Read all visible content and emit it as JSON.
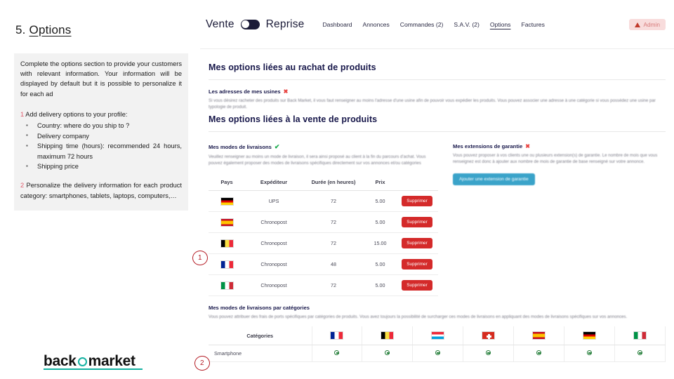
{
  "slide": {
    "number": "5.",
    "title": "Options",
    "intro": "Complete the options section to provide your customers with relevant information. Your information will be displayed by default but it is possible to personalize it for each ad",
    "step1_num": "1",
    "step1_title": "Add delivery options to your profile:",
    "step1_bullets": [
      "Country: where do you ship to ?",
      "Delivery company",
      "Shipping time (hours): recommended 24 hours, maximum 72 hours",
      "Shipping price"
    ],
    "step2_num": "2",
    "step2_text": "Personalize the delivery information for each product category: smartphones, tablets, laptops, computers,…",
    "annotation_1": "1",
    "annotation_2": "2"
  },
  "logo": {
    "left": "back",
    "right": "market",
    "ring_color": "#13b1a1"
  },
  "app": {
    "mode_left": "Vente",
    "mode_right": "Reprise",
    "toggle_state": "left",
    "nav": [
      {
        "label": "Dashboard",
        "active": false
      },
      {
        "label": "Annonces",
        "active": false
      },
      {
        "label": "Commandes (2)",
        "active": false
      },
      {
        "label": "S.A.V. (2)",
        "active": false
      },
      {
        "label": "Options",
        "active": true
      },
      {
        "label": "Factures",
        "active": false
      }
    ],
    "admin_label": "Admin"
  },
  "section_buyback": {
    "heading": "Mes options liées au rachat de produits",
    "sub_heading": "Les adresses de mes usines",
    "sub_status": "x",
    "body": "Si vous désirez racheter des produits sur Back Market, il vous faut renseigner au moins l'adresse d'une usine afin de pouvoir vous expédier les produits. Vous pouvez associer une adresse à une catégorie si vous possédez une usine par typologie de produit."
  },
  "section_sale": {
    "heading": "Mes options liées à la vente de produits"
  },
  "delivery_panel": {
    "heading": "Mes modes de livraisons",
    "status": "check",
    "body": "Veuillez renseigner au moins un mode de livraison, il sera ainsi proposé au client à la fin du parcours d'achat. Vous pouvez également proposer des modes de livraisons spécifiques directement sur vos annonces et/ou catégories",
    "table": {
      "columns": [
        "Pays",
        "Expéditeur",
        "Durée (en heures)",
        "Prix",
        ""
      ],
      "rows": [
        {
          "flag": "f-de",
          "country": "Germany",
          "carrier": "UPS",
          "duration": "72",
          "price": "5.00",
          "action": "Supprimer"
        },
        {
          "flag": "f-es",
          "country": "Spain",
          "carrier": "Chronopost",
          "duration": "72",
          "price": "5.00",
          "action": "Supprimer"
        },
        {
          "flag": "f-be",
          "country": "Belgium",
          "carrier": "Chronopost",
          "duration": "72",
          "price": "15.00",
          "action": "Supprimer"
        },
        {
          "flag": "f-fr",
          "country": "France",
          "carrier": "Chronopost",
          "duration": "48",
          "price": "5.00",
          "action": "Supprimer"
        },
        {
          "flag": "f-it",
          "country": "Italy",
          "carrier": "Chronopost",
          "duration": "72",
          "price": "5.00",
          "action": "Supprimer"
        }
      ]
    }
  },
  "warranty_panel": {
    "heading": "Mes extensions de garantie",
    "status": "x",
    "body": "Vous pouvez proposer à vos clients une ou plusieurs extension(s) de garantie. Le nombre de mois que vous renseignez est donc à ajouter aux nombre de mois de garantie de base renseigné sur votre annonce.",
    "add_button": "Ajouter une extension de garantie",
    "button_color": "#3aa3c9"
  },
  "categories_panel": {
    "heading": "Mes modes de livraisons par catégories",
    "body": "Vous pouvez attribuer des frais de ports spécifiques par catégories de produits. Vous avez toujours la possibilité de surcharger ces modes de livraisons en appliquant des modes de livraisons spécifiques sur vos annonces.",
    "col_label": "Catégories",
    "country_flags": [
      "f-fr",
      "f-be",
      "f-lu",
      "f-ch",
      "f-es",
      "f-de",
      "f-it"
    ],
    "country_names": [
      "France",
      "Belgium",
      "Luxembourg",
      "Switzerland",
      "Spain",
      "Germany",
      "Italy"
    ],
    "rows": [
      {
        "name": "Smartphone",
        "marks": [
          "add",
          "add",
          "add",
          "add",
          "add",
          "add",
          "add"
        ]
      }
    ]
  }
}
